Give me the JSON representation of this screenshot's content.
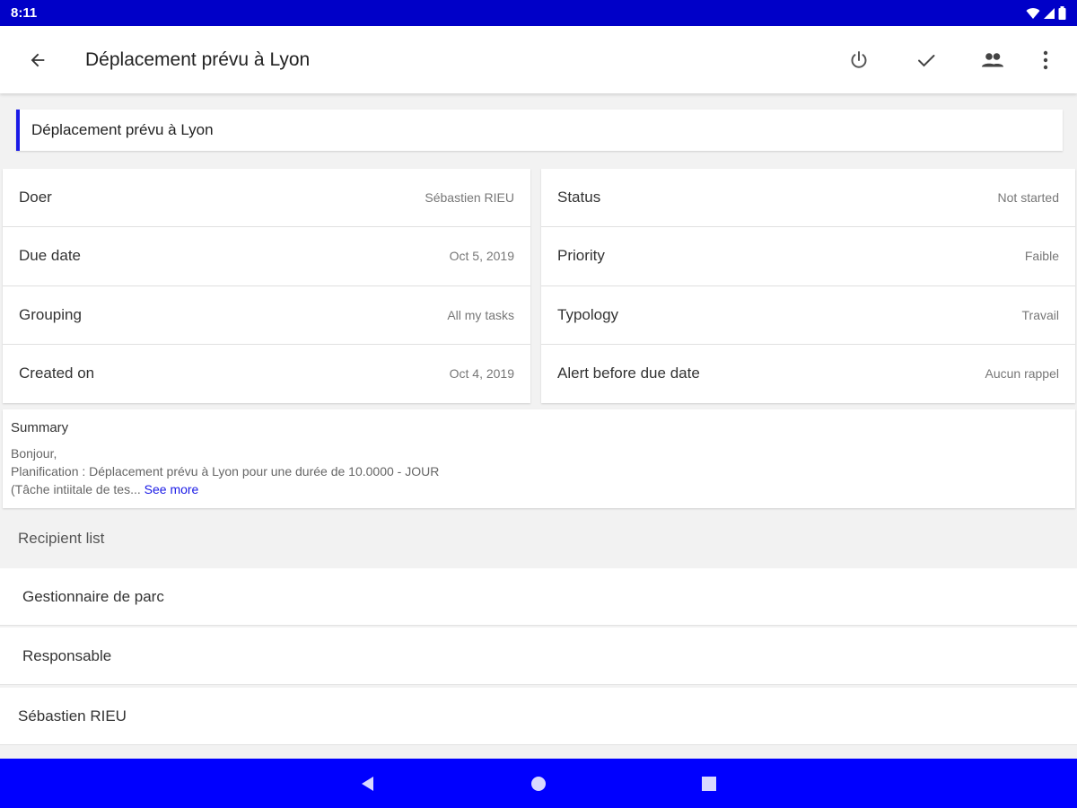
{
  "status_bar": {
    "time": "8:11"
  },
  "app_bar": {
    "title": "Déplacement prévu à Lyon",
    "icons": [
      "back-icon",
      "power-icon",
      "check-icon",
      "people-icon",
      "more-vert-icon"
    ]
  },
  "task_title": "Déplacement prévu à Lyon",
  "details_left": [
    {
      "label": "Doer",
      "value": "Sébastien RIEU"
    },
    {
      "label": "Due date",
      "value": "Oct 5, 2019"
    },
    {
      "label": "Grouping",
      "value": "All my tasks"
    },
    {
      "label": "Created on",
      "value": "Oct 4, 2019"
    }
  ],
  "details_right": [
    {
      "label": "Status",
      "value": "Not started"
    },
    {
      "label": "Priority",
      "value": "Faible"
    },
    {
      "label": "Typology",
      "value": "Travail"
    },
    {
      "label": "Alert before due date",
      "value": "Aucun rappel"
    }
  ],
  "summary": {
    "title": "Summary",
    "line1": "Bonjour,",
    "line2": "Planification : Déplacement prévu à Lyon pour une durée de 10.0000 - JOUR",
    "line3": "(Tâche intiitale de tes...",
    "see_more": "See more"
  },
  "recipients": {
    "header": "Recipient list",
    "items": [
      "Gestionnaire de parc",
      "Responsable",
      "Sébastien RIEU"
    ]
  },
  "colors": {
    "status_bar": "#0000c8",
    "nav_bar": "#0000ff",
    "accent": "#1a1ae6"
  }
}
